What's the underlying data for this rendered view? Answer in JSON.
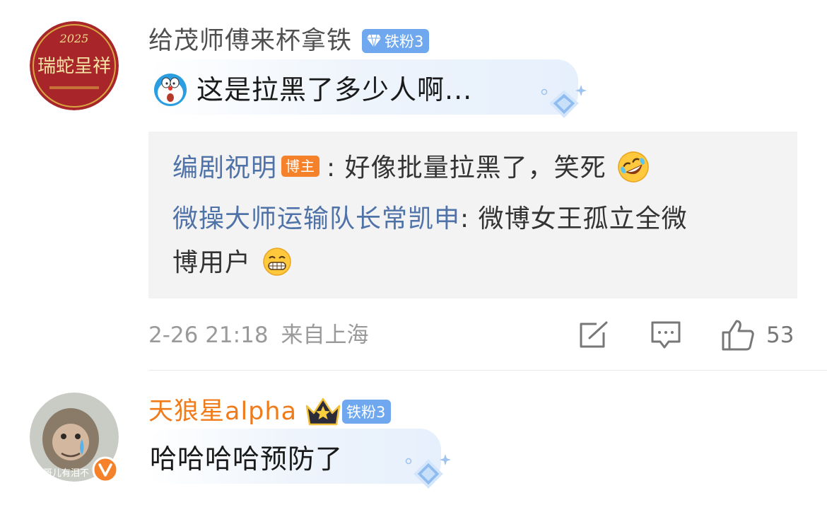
{
  "comment1": {
    "avatar_text": "瑞蛇呈祥",
    "avatar_year": "2025",
    "username": "给茂师傅来杯拿铁",
    "badge": "铁粉3",
    "text": "这是拉黑了多少人啊...",
    "replies": [
      {
        "user": "编剧祝明",
        "tag": "博主",
        "sep": ":",
        "text": "好像批量拉黑了，笑死"
      },
      {
        "user": "微操大师运输队长常凯申",
        "sep": ":",
        "text_line1": "微博女王孤立全微",
        "text_line2": "博用户"
      }
    ],
    "date": "2-26 21:18",
    "location": "来自上海",
    "likes": "53"
  },
  "comment2": {
    "avatar_text": "大哥儿有泪不",
    "username": "天狼星alpha",
    "badge": "铁粉3",
    "text": "哈哈哈哈预防了"
  },
  "colors": {
    "accent_orange": "#f07b1b",
    "reply_user_blue": "#4f73a8",
    "badge_blue": "#6fa8ef"
  }
}
